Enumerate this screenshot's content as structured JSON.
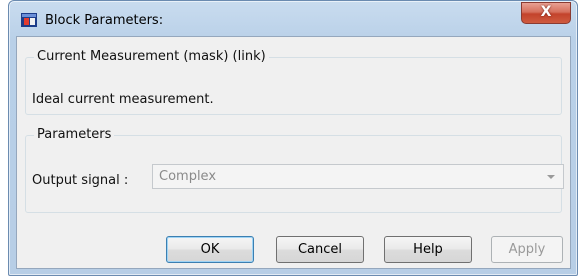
{
  "window": {
    "title": "Block Parameters:"
  },
  "title_controls": {
    "close_glyph": "X"
  },
  "block_group": {
    "legend": "Current Measurement (mask) (link)",
    "description": "Ideal current measurement."
  },
  "parameters_group": {
    "legend": "Parameters",
    "output_signal": {
      "label": "Output signal :",
      "value": "Complex"
    }
  },
  "buttons": {
    "ok": "OK",
    "cancel": "Cancel",
    "help": "Help",
    "apply": "Apply"
  },
  "colors": {
    "titlebar": "#b9d0e8",
    "close": "#c3432c",
    "client": "#f0f0f0"
  },
  "icons": {
    "app": "simulink-block-icon",
    "close": "close-icon",
    "dropdown": "chevron-down-icon"
  }
}
